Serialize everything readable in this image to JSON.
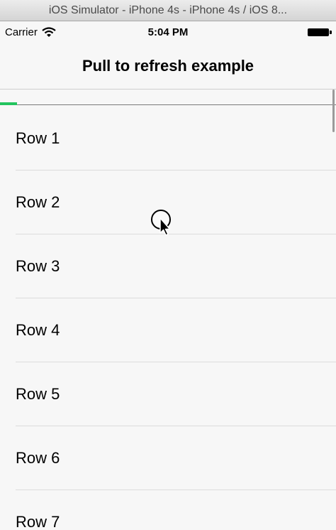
{
  "window": {
    "title": "iOS Simulator - iPhone 4s - iPhone 4s / iOS 8..."
  },
  "status_bar": {
    "carrier": "Carrier",
    "time": "5:04 PM",
    "icons": [
      "wifi-icon",
      "battery-icon"
    ]
  },
  "nav": {
    "title": "Pull to refresh example"
  },
  "refresh": {
    "progress_percent": 5,
    "color": "#23c45e"
  },
  "rows": [
    "Row 1",
    "Row 2",
    "Row 3",
    "Row 4",
    "Row 5",
    "Row 6",
    "Row 7"
  ]
}
